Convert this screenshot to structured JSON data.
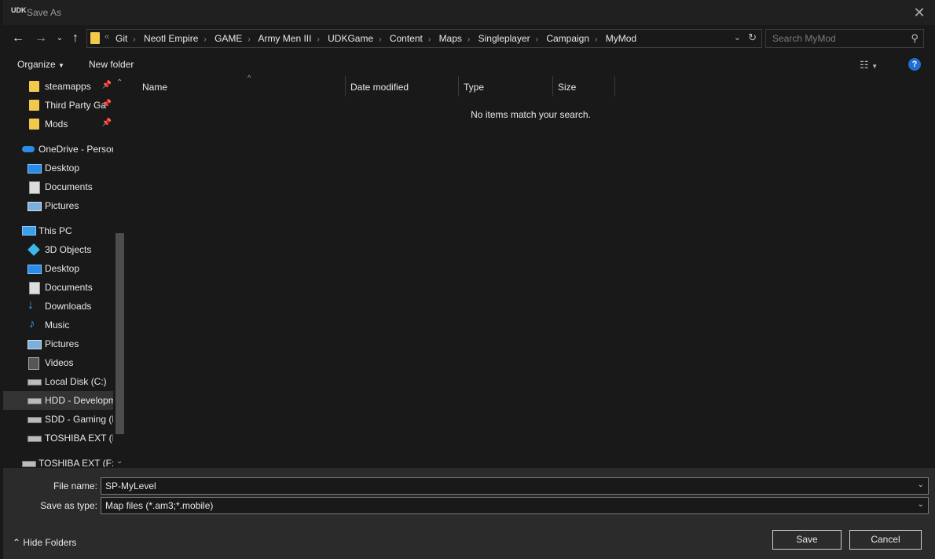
{
  "window": {
    "title": "Save As",
    "icon_text": "UDK"
  },
  "address": {
    "overflow": "«",
    "crumbs": [
      "Git",
      "Neotl Empire",
      "GAME",
      "Army Men III",
      "UDKGame",
      "Content",
      "Maps",
      "Singleplayer",
      "Campaign",
      "MyMod"
    ]
  },
  "search": {
    "placeholder": "Search MyMod"
  },
  "toolbar": {
    "organize": "Organize",
    "new_folder": "New folder"
  },
  "nav": {
    "items": [
      {
        "label": "steamapps",
        "icon": "folder-icon",
        "pinned": true
      },
      {
        "label": "Third Party Ga",
        "icon": "folder-icon",
        "pinned": true
      },
      {
        "label": "Mods",
        "icon": "folder-icon",
        "pinned": true
      },
      {
        "label": "OneDrive - Person",
        "icon": "cloud-icon"
      },
      {
        "label": "Desktop",
        "icon": "desktop-icon"
      },
      {
        "label": "Documents",
        "icon": "documents-icon"
      },
      {
        "label": "Pictures",
        "icon": "pictures-icon"
      },
      {
        "label": "This PC",
        "icon": "computer-icon"
      },
      {
        "label": "3D Objects",
        "icon": "cube-icon"
      },
      {
        "label": "Desktop",
        "icon": "desktop-icon"
      },
      {
        "label": "Documents",
        "icon": "documents-icon"
      },
      {
        "label": "Downloads",
        "icon": "download-icon"
      },
      {
        "label": "Music",
        "icon": "music-icon"
      },
      {
        "label": "Pictures",
        "icon": "pictures-icon"
      },
      {
        "label": "Videos",
        "icon": "videos-icon"
      },
      {
        "label": "Local Disk (C:)",
        "icon": "drive-icon"
      },
      {
        "label": "HDD - Developm",
        "icon": "drive-icon",
        "selected": true
      },
      {
        "label": "SDD - Gaming (E",
        "icon": "drive-icon"
      },
      {
        "label": "TOSHIBA EXT (F:)",
        "icon": "drive-icon"
      },
      {
        "label": "TOSHIBA EXT (F:)",
        "icon": "drive-icon"
      }
    ]
  },
  "columns": [
    "Name",
    "Date modified",
    "Type",
    "Size"
  ],
  "empty_message": "No items match your search.",
  "form": {
    "file_name_label": "File name:",
    "file_name_value": "SP-MyLevel",
    "save_type_label": "Save as type:",
    "save_type_value": "Map files (*.am3;*.mobile)"
  },
  "footer": {
    "hide_folders": "Hide Folders",
    "save": "Save",
    "cancel": "Cancel"
  },
  "colors": {
    "accent": "#1f6fd1",
    "folder": "#f2c94c",
    "background": "#191919",
    "panel": "#2b2b2b"
  }
}
